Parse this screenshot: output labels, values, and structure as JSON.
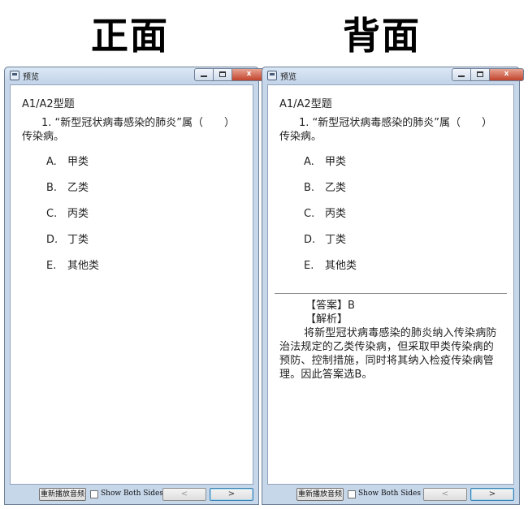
{
  "headers": {
    "front": "正面",
    "back": "背面"
  },
  "window": {
    "title": "预览",
    "close_glyph": "x"
  },
  "question": {
    "type": "A1/A2型题",
    "stem": "1. “新型冠状病毒感染的肺炎”属（　　）传染病。",
    "options": [
      {
        "letter": "A.",
        "text": "甲类"
      },
      {
        "letter": "B.",
        "text": "乙类"
      },
      {
        "letter": "C.",
        "text": "丙类"
      },
      {
        "letter": "D.",
        "text": "丁类"
      },
      {
        "letter": "E.",
        "text": "其他类"
      }
    ]
  },
  "answer": {
    "label": "【答案】B",
    "analysis_label": "【解析】",
    "analysis_text": "将新型冠状病毒感染的肺炎纳入传染病防治法规定的乙类传染病，但采取甲类传染病的预防、控制措施，同时将其纳入检疫传染病管理。因此答案选B。"
  },
  "footer": {
    "replay_label": "重新播放音频",
    "show_both_label": "Show Both Sides",
    "prev_label": "<",
    "next_label": ">"
  }
}
